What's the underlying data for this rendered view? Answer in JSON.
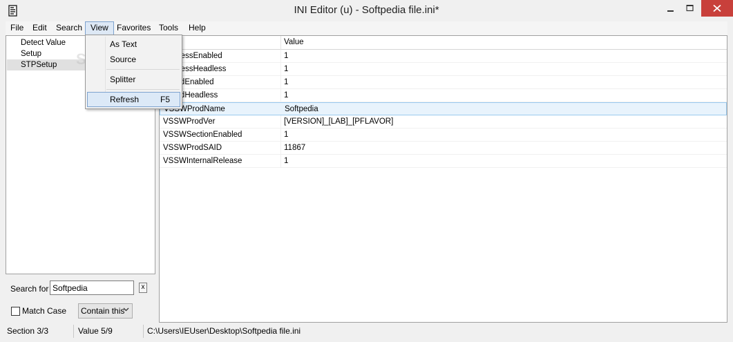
{
  "window": {
    "title": "INI Editor (u) - Softpedia file.ini*",
    "icon": "app-document-icon"
  },
  "menu": [
    {
      "label": "File"
    },
    {
      "label": "Edit"
    },
    {
      "label": "Search"
    },
    {
      "label": "View"
    },
    {
      "label": "Favorites"
    },
    {
      "label": "Tools"
    },
    {
      "label": "Help"
    }
  ],
  "view_menu": {
    "items": [
      {
        "label": "As Text",
        "shortcut": ""
      },
      {
        "label": "Source",
        "shortcut": ""
      },
      {
        "label": "Splitter",
        "shortcut": ""
      },
      {
        "label": "Refresh",
        "shortcut": "F5"
      }
    ]
  },
  "sections": [
    {
      "label": "Detect Value"
    },
    {
      "label": "Setup"
    },
    {
      "label": "STPSetup"
    }
  ],
  "watermark": "SOFTPEDIA",
  "search": {
    "label": "Search for",
    "value": "Softpedia",
    "clear_label": "x",
    "match_case_label": "Match Case",
    "match_case_checked": false,
    "mode_value": "Contain this"
  },
  "grid": {
    "header_value": "Value",
    "rows": [
      {
        "name": "SuccessEnabled",
        "value": "1"
      },
      {
        "name": "SuccessHeadless",
        "value": "1"
      },
      {
        "name": "FailedEnabled",
        "value": "1"
      },
      {
        "name": "FailedHeadless",
        "value": "1"
      },
      {
        "name": "VSSWProdName",
        "value": "Softpedia"
      },
      {
        "name": "VSSWProdVer",
        "value": "[VERSION]_[LAB]_[PFLAVOR]"
      },
      {
        "name": "VSSWSectionEnabled",
        "value": "1"
      },
      {
        "name": "VSSWProdSAID",
        "value": "11867"
      },
      {
        "name": "VSSWInternalRelease",
        "value": "1"
      }
    ]
  },
  "status": {
    "section": "Section 3/3",
    "value": "Value 5/9",
    "path": "C:\\Users\\IEUser\\Desktop\\Softpedia file.ini"
  },
  "colors": {
    "close_button": "#c8403b",
    "selection": "#e8f3fc",
    "menu_highlight": "#dde8f5"
  }
}
